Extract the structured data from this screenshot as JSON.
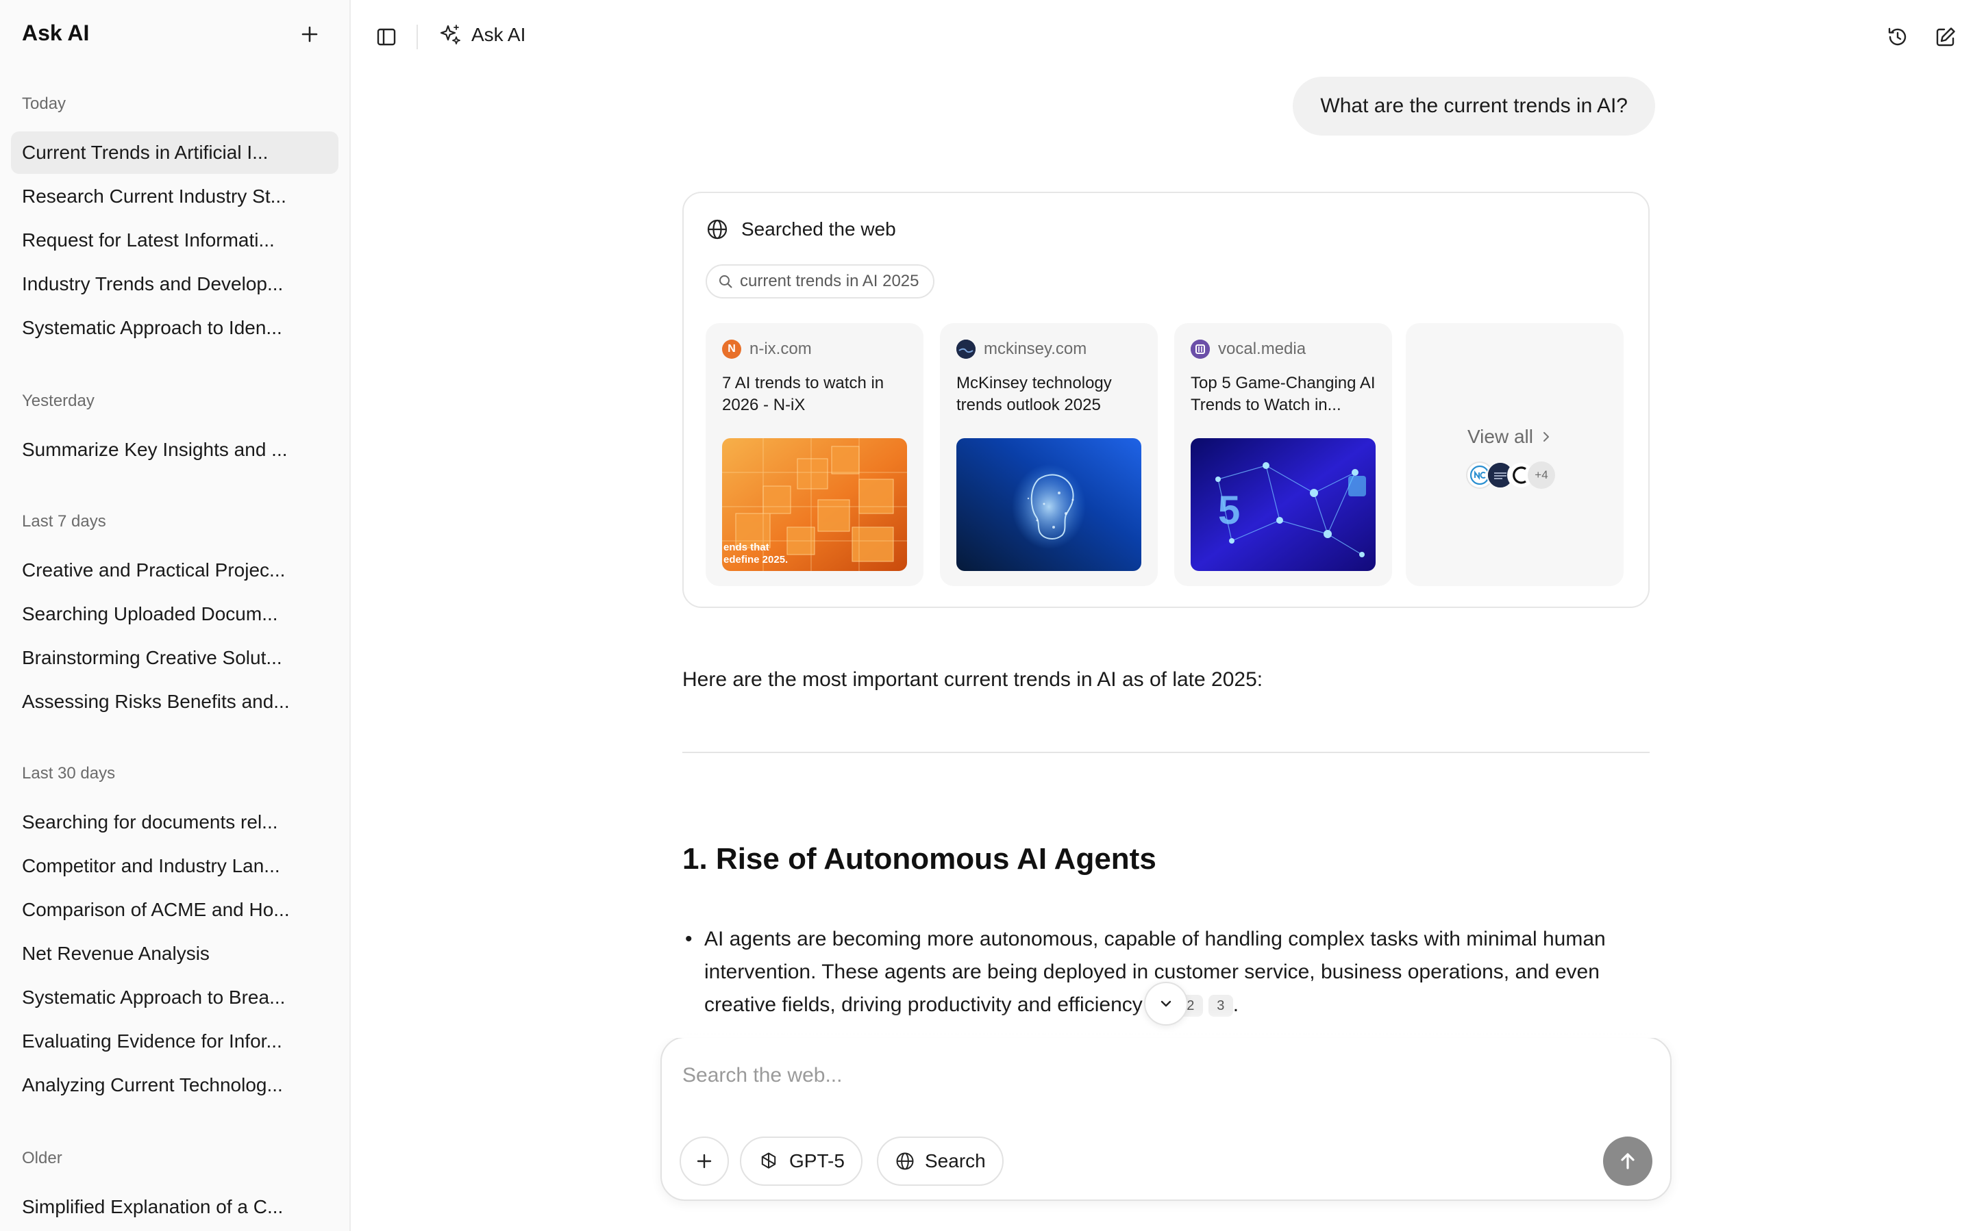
{
  "sidebar": {
    "title": "Ask AI",
    "new_chat_icon": "plus-icon",
    "groups": [
      {
        "label": "Today",
        "items": [
          "Current Trends in Artificial I...",
          "Research Current Industry St...",
          "Request for Latest Informati...",
          "Industry Trends and Develop...",
          "Systematic Approach to Iden..."
        ]
      },
      {
        "label": "Yesterday",
        "items": [
          "Summarize Key Insights and ..."
        ]
      },
      {
        "label": "Last 7 days",
        "items": [
          "Creative and Practical Projec...",
          "Searching Uploaded Docum...",
          "Brainstorming Creative Solut...",
          "Assessing Risks Benefits and..."
        ]
      },
      {
        "label": "Last 30 days",
        "items": [
          "Searching for documents rel...",
          "Competitor and Industry Lan...",
          "Comparison of ACME and Ho...",
          "Net Revenue Analysis",
          "Systematic Approach to Brea...",
          "Evaluating Evidence for Infor...",
          "Analyzing Current Technolog..."
        ]
      },
      {
        "label": "Older",
        "items": [
          "Simplified Explanation of a C..."
        ]
      }
    ]
  },
  "topbar": {
    "brand": "Ask AI",
    "brand_icon": "sparkles-icon"
  },
  "chat": {
    "user_message": "What are the current trends in AI?",
    "search": {
      "heading": "Searched the web",
      "query": "current trends in AI 2025",
      "sources": [
        {
          "domain": "n-ix.com",
          "title": "7 AI trends to watch in 2026 - N-iX",
          "favicon_letter": "N",
          "favicon_color": "#e8702a",
          "thumb_caption_1": "ends that",
          "thumb_caption_2": "edefine 2025."
        },
        {
          "domain": "mckinsey.com",
          "title": "McKinsey technology trends outlook 2025",
          "favicon_letter": "",
          "favicon_color": "#1d2a4a"
        },
        {
          "domain": "vocal.media",
          "title": "Top 5 Game-Changing AI Trends to Watch in...",
          "favicon_letter": "",
          "favicon_color": "#6b4fa8",
          "thumb_caption_1": "5"
        }
      ],
      "view_all": "View all",
      "more_count": "+4"
    },
    "answer_intro": "Here are the most important current trends in AI as of late 2025:",
    "section_heading": "1. Rise of Autonomous AI Agents",
    "bullets": [
      {
        "text": "AI agents are becoming more autonomous, capable of handling complex tasks with minimal human intervention. These agents are being deployed in customer service, business operations, and even creative fields, driving productivity and efficiency",
        "citations": [
          "1",
          "2",
          "3"
        ],
        "end": "."
      }
    ]
  },
  "composer": {
    "placeholder": "Search the web...",
    "model_label": "GPT-5",
    "search_label": "Search"
  },
  "colors": {
    "accent_gray": "#8a8a8a",
    "active_item": "#ececec"
  }
}
